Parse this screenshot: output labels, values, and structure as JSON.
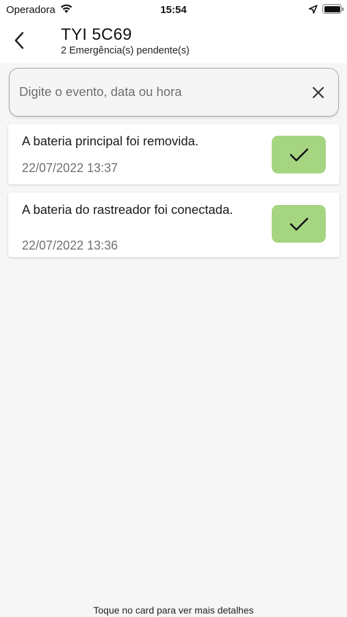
{
  "status_bar": {
    "carrier": "Operadora",
    "time": "15:54",
    "icons": [
      "wifi-icon",
      "location-arrow-icon",
      "battery-icon"
    ]
  },
  "header": {
    "back_icon": "chevron-left-icon",
    "title": "TYI 5C69",
    "subtitle": "2 Emergência(s) pendente(s)"
  },
  "search": {
    "placeholder": "Digite o evento, data ou hora",
    "value": "",
    "clear_icon": "close-icon"
  },
  "events": [
    {
      "text": "A bateria principal foi removida.",
      "datetime": "22/07/2022 13:37",
      "action_icon": "checkmark-icon"
    },
    {
      "text": "A bateria do rastreador foi conectada.",
      "datetime": "22/07/2022 13:36",
      "action_icon": "checkmark-icon"
    }
  ],
  "footer": {
    "hint": "Toque no card para ver mais detalhes"
  },
  "colors": {
    "background": "#f6f6f6",
    "card": "#ffffff",
    "acknowledge_button": "#a6d582",
    "date_text": "#707070"
  }
}
